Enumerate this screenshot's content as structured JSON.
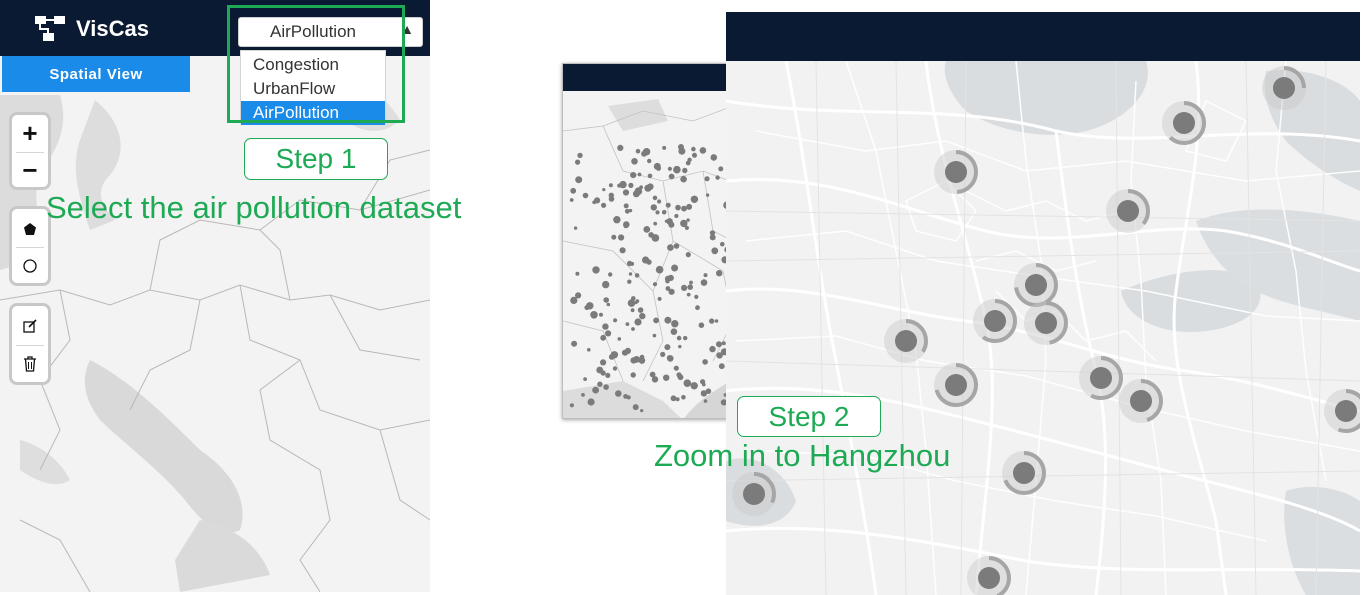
{
  "app": {
    "title": "VisCas",
    "view_tab": "Spatial View"
  },
  "dataset_select": {
    "value": "AirPollution",
    "options": [
      "Congestion",
      "UrbanFlow",
      "AirPollution"
    ],
    "selected_index": 2
  },
  "map_controls": {
    "zoom_in": "+",
    "zoom_out": "−",
    "tools": [
      "polygon-icon",
      "circle-icon",
      "edit-icon",
      "trash-icon"
    ]
  },
  "steps": [
    {
      "label": "Step 1",
      "caption": "Select the air pollution dataset"
    },
    {
      "label": "Step 2",
      "caption": "Zoom in to Hangzhou"
    }
  ],
  "colors": {
    "header": "#0b1a33",
    "accent_blue": "#1a8be8",
    "callout_green": "#1eaa55",
    "marker_gray": "#7b7b7b"
  }
}
